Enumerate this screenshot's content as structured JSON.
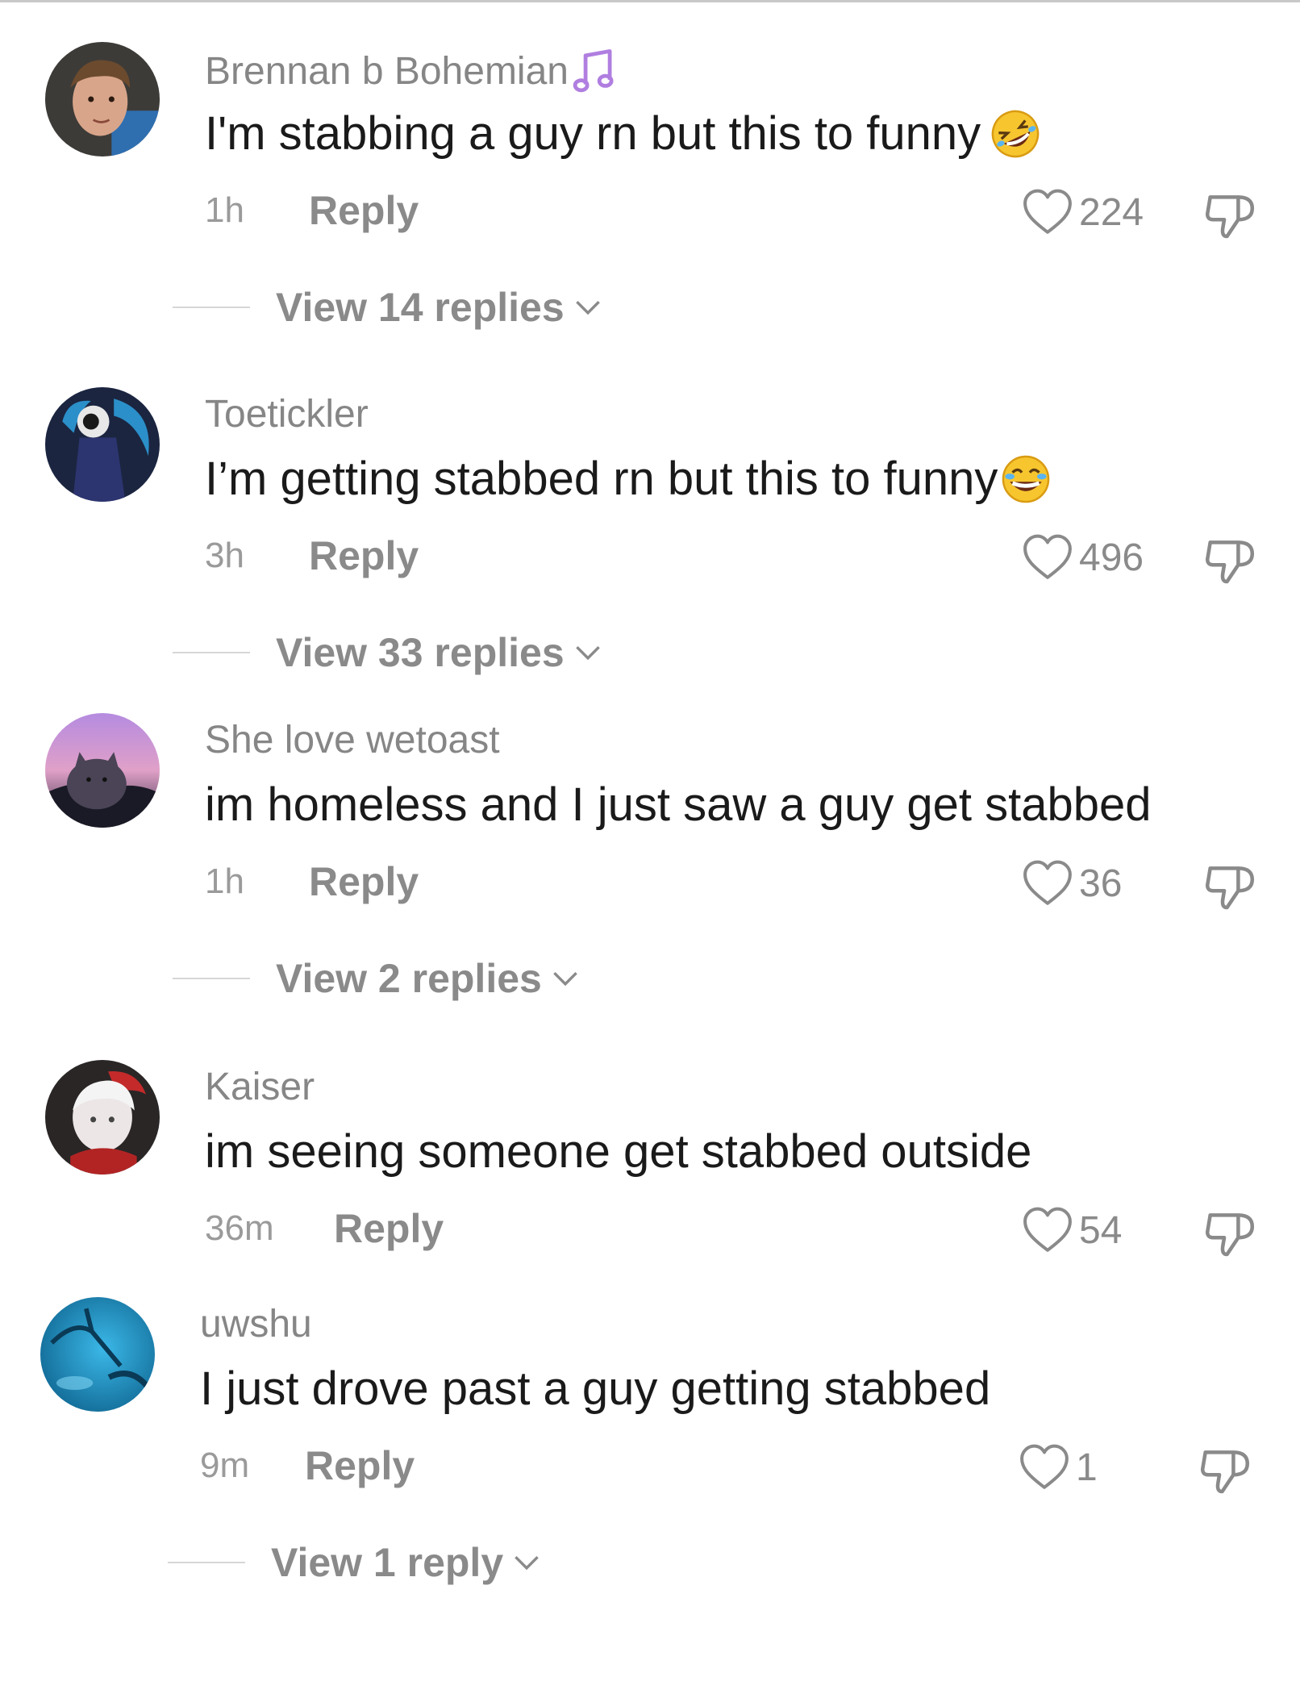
{
  "colors": {
    "text_primary": "#1a1a1a",
    "text_secondary": "#868686",
    "music_note": "#b07ee0"
  },
  "comments": [
    {
      "username": "Brennan b Bohemian",
      "username_icon": "music-note-icon",
      "text": "I'm stabbing a guy rn but this to funny",
      "emoji": "rolling-laughing-emoji",
      "time": "1h",
      "reply_label": "Reply",
      "likes": "224",
      "view_replies": "View 14 replies"
    },
    {
      "username": "Toetickler",
      "text": "I’m getting stabbed rn but this to funny",
      "emoji": "grinning-sweat-emoji",
      "time": "3h",
      "reply_label": "Reply",
      "likes": "496",
      "view_replies": "View 33 replies"
    },
    {
      "username": "She love wetoast",
      "text": "im homeless and I just saw a guy get stabbed",
      "time": "1h",
      "reply_label": "Reply",
      "likes": "36",
      "view_replies": "View 2 replies"
    },
    {
      "username": "Kaiser",
      "text": "im seeing someone get stabbed outside",
      "time": "36m",
      "reply_label": "Reply",
      "likes": "54"
    },
    {
      "username": "uwshu",
      "text": "I just drove past a guy getting stabbed",
      "time": "9m",
      "reply_label": "Reply",
      "likes": "1",
      "view_replies": "View 1 reply"
    }
  ]
}
